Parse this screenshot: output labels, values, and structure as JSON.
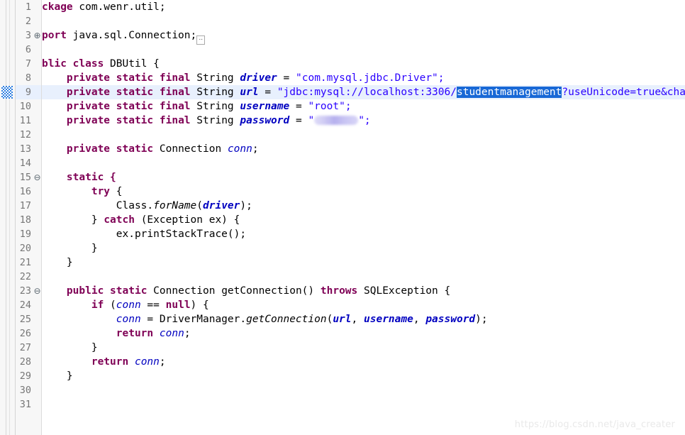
{
  "editor": {
    "language": "Java",
    "selected_text": "studentmanagement",
    "current_line": 9,
    "colors": {
      "keyword": "#7f0055",
      "field": "#0000c0",
      "string": "#2a00ff",
      "selection_bg": "#1868d6",
      "current_line_bg": "#e8f0fd",
      "gutter_bg": "#f7f7f7",
      "line_number": "#767676",
      "change_marker": "#2f7fe0"
    },
    "line_numbers": [
      1,
      2,
      3,
      6,
      7,
      8,
      9,
      10,
      11,
      12,
      13,
      14,
      15,
      16,
      17,
      18,
      19,
      20,
      21,
      22,
      23,
      24,
      25,
      26,
      27,
      28,
      29,
      30,
      31
    ],
    "fold_icons": {
      "line_3": "+",
      "line_15": "-",
      "line_23": "-"
    },
    "lines": {
      "l1": "ckage com.wenr.util;",
      "l2": "",
      "l3": "port java.sql.Connection;",
      "l6": "",
      "l7": "blic class DBUtil {",
      "l8": "    private static final String driver = \"com.mysql.jdbc.Driver\";",
      "l9": "    private static final String url = \"jdbc:mysql://localhost:3306/studentmanagement?useUnicode=true&char",
      "l10": "    private static final String username = \"root\";",
      "l11": "    private static final String password = \"••••••\";",
      "l12": "",
      "l13": "    private static Connection conn;",
      "l14": "",
      "l15": "    static {",
      "l16": "        try {",
      "l17": "            Class.forName(driver);",
      "l18": "        } catch (Exception ex) {",
      "l19": "            ex.printStackTrace();",
      "l20": "        }",
      "l21": "    }",
      "l22": "",
      "l23": "    public static Connection getConnection() throws SQLException {",
      "l24": "        if (conn == null) {",
      "l25": "            conn = DriverManager.getConnection(url, username, password);",
      "l26": "            return conn;",
      "l27": "        }",
      "l28": "        return conn;",
      "l29": "    }",
      "l30": "",
      "l31": ""
    },
    "tokens": {
      "pkg_partial": "ckage",
      "pkg_name": " com.wenr.util;",
      "imp_partial": "port",
      "imp_name": " java.sql.Connection;",
      "pub_partial": "blic",
      "kw_class": "class",
      "class_name": "DBUtil {",
      "kw_private": "private",
      "kw_static": "static",
      "kw_final": "final",
      "kw_public": "public",
      "kw_try": "try",
      "kw_catch": "catch",
      "kw_if": "if",
      "kw_null": "null",
      "kw_return": "return",
      "kw_throws": "throws",
      "type_string": "String",
      "type_connection": "Connection",
      "fld_driver": "driver",
      "fld_url": "url",
      "fld_username": "username",
      "fld_password": "password",
      "fld_conn": "conn",
      "str_driver": "\"com.mysql.jdbc.Driver\";",
      "str_url_open": "\"jdbc:mysql://localhost:3306/",
      "str_url_selected": "studentmanagement",
      "str_url_tail": "?useUnicode=true&char",
      "str_root": "\"root\";",
      "static_block": "static {",
      "try_open": "try {",
      "class_forname": "Class.",
      "mth_forname": "forName",
      "forname_args": ");",
      "catch_open": "} ",
      "catch_args": " (Exception ex) {",
      "ex_print": "ex.printStackTrace();",
      "brace_close": "}",
      "method_sig_pre": "Connection getConnection() ",
      "method_sig_post": "SQLException {",
      "if_cond": " (",
      "if_eq": " == ",
      "if_close": ") {",
      "conn_assign": " = DriverManager.",
      "mth_getconnection": "getConnection",
      "paren_open": "(",
      "comma": ", ",
      "paren_close": ");",
      "semi": ";"
    }
  },
  "watermark": {
    "text": "https://blog.csdn.net/java_creater"
  }
}
